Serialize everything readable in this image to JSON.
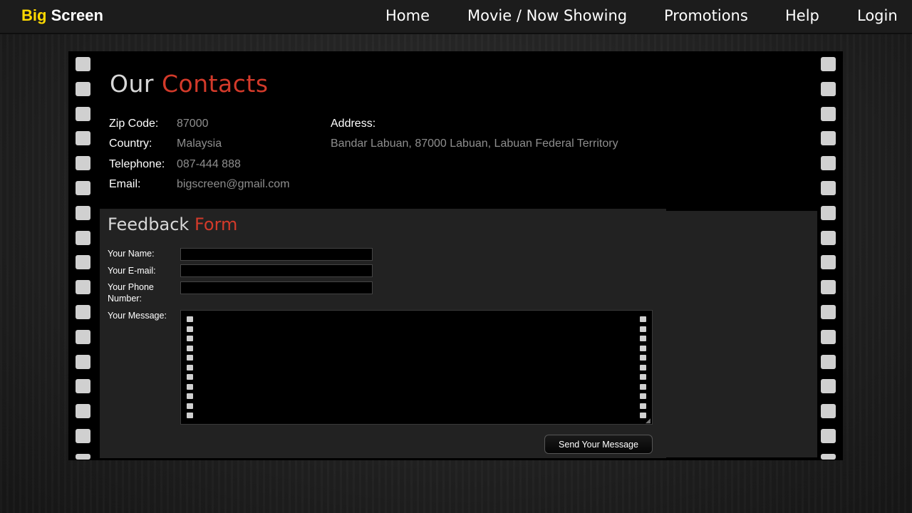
{
  "header": {
    "logo_part1": "Big",
    "logo_part2": "Screen",
    "nav": {
      "home": "Home",
      "movies": "Movie / Now Showing",
      "promotions": "Promotions",
      "help": "Help",
      "login": "Login"
    }
  },
  "contacts": {
    "title_part1": "Our",
    "title_part2": "Contacts",
    "zip_label": "Zip Code:",
    "zip_value": "87000",
    "country_label": "Country:",
    "country_value": "Malaysia",
    "telephone_label": "Telephone:",
    "telephone_value": "087-444 888",
    "email_label": "Email:",
    "email_value": "bigscreen@gmail.com",
    "address_label": "Address:",
    "address_value": "Bandar Labuan, 87000 Labuan, Labuan Federal Territory"
  },
  "feedback": {
    "title_part1": "Feedback",
    "title_part2": "Form",
    "name_label": "Your Name:",
    "name_value": "",
    "email_label": "Your E-mail:",
    "email_value": "",
    "phone_label": "Your Phone Number:",
    "phone_value": "",
    "message_label": "Your Message:",
    "message_value": "",
    "submit_label": "Send Your Message"
  },
  "colors": {
    "logo_accent": "#ffd900",
    "heading_accent": "#d33a2a",
    "muted_text": "#8e8e8e"
  }
}
